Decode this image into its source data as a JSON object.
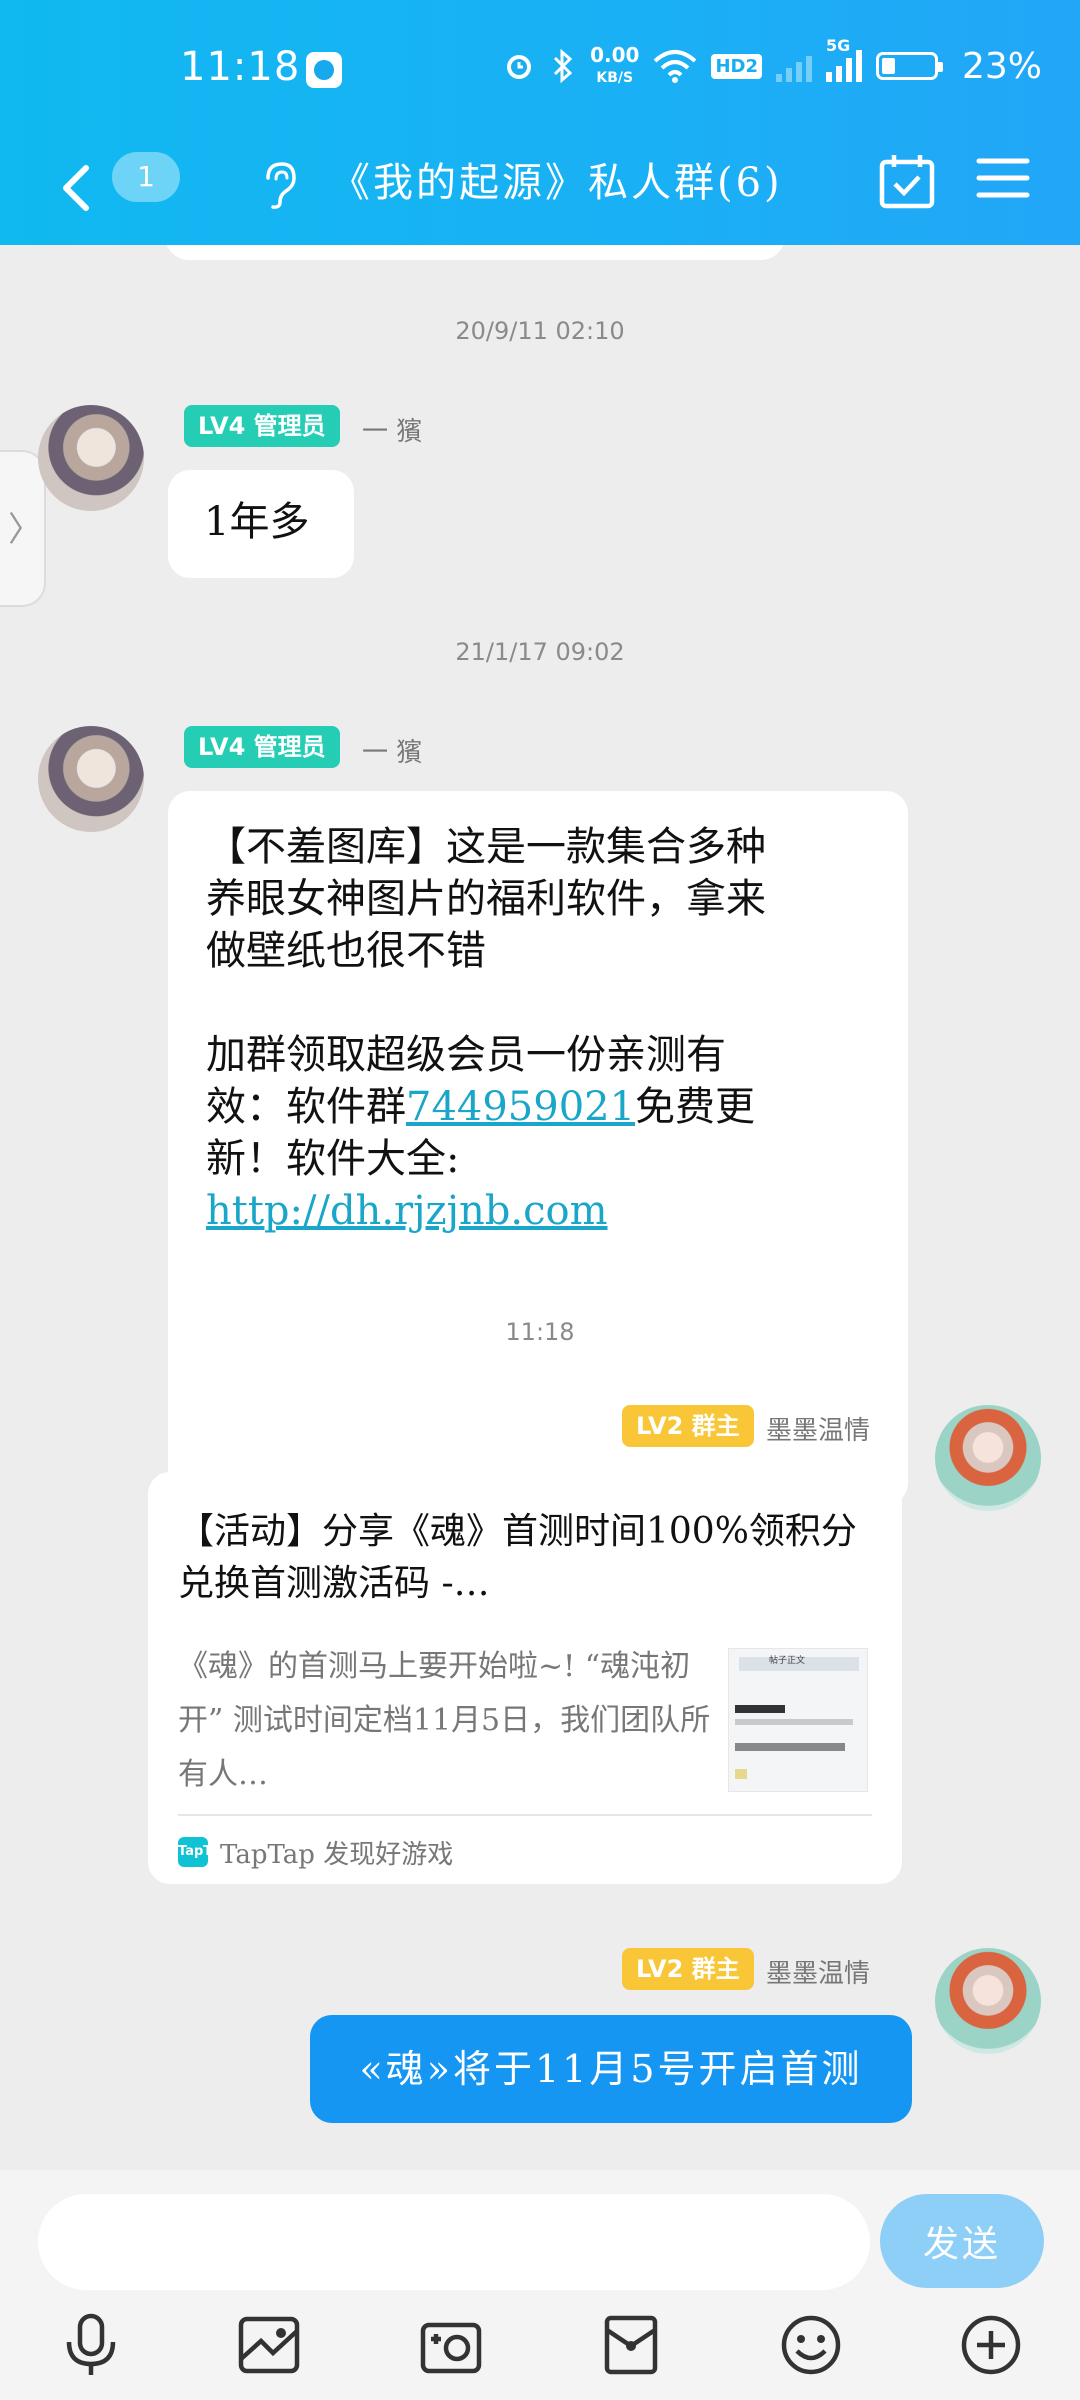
{
  "status_bar": {
    "time": "11:18",
    "net_speed_value": "0.00",
    "net_speed_unit": "KB/S",
    "hd_label": "HD2",
    "signal_label": "5G",
    "battery": "23%"
  },
  "navbar": {
    "unread_count": "1",
    "title": "《我的起源》私人群(6)"
  },
  "messages": [
    {
      "timestamp": "20/9/11 02:10",
      "badge": "LV4 管理员",
      "sender": "一 獱",
      "text": "1年多"
    },
    {
      "timestamp": "21/1/17 09:02",
      "badge": "LV4 管理员",
      "sender": "一 獱",
      "lines": [
        "【不羞图库】这是一款集合多种",
        "养眼女神图片的福利软件，拿来",
        "做壁纸也很不错"
      ],
      "para2_a": "加群领取超级会员一份亲测有",
      "para2_b": "效：软件群",
      "group_number": "744959021",
      "para2_c": "免费更",
      "para2_d": "新！软件大全:",
      "url": "http://dh.rjzjnb.com"
    },
    {
      "timestamp": "11:18",
      "badge": "LV2 群主",
      "sender": "墨墨温情",
      "share_title": "【活动】分享《魂》首测时间100%领积分兑换首测激活码 -…",
      "share_desc": "《魂》的首测马上要开始啦~! “魂沌初开” 测试时间定档11月5日，我们团队所有人…",
      "thumb_title": "帖子正文",
      "source_icon": "TapTap",
      "source": "TapTap 发现好游戏"
    },
    {
      "badge": "LV2 群主",
      "sender": "墨墨温情",
      "text": "«魂»将于11月5号开启首测"
    }
  ],
  "input": {
    "value": "",
    "placeholder": "",
    "send_label": "发送"
  },
  "toolbar": {
    "icons": [
      "microphone-icon",
      "image-icon",
      "camera-icon",
      "red-packet-icon",
      "emoji-icon",
      "plus-icon"
    ]
  },
  "colors": {
    "header": "#1ab0f5",
    "admin_badge": "#26cdb5",
    "owner_badge": "#f8c637",
    "own_bubble": "#1596f2",
    "send_button": "#8ecff7"
  }
}
